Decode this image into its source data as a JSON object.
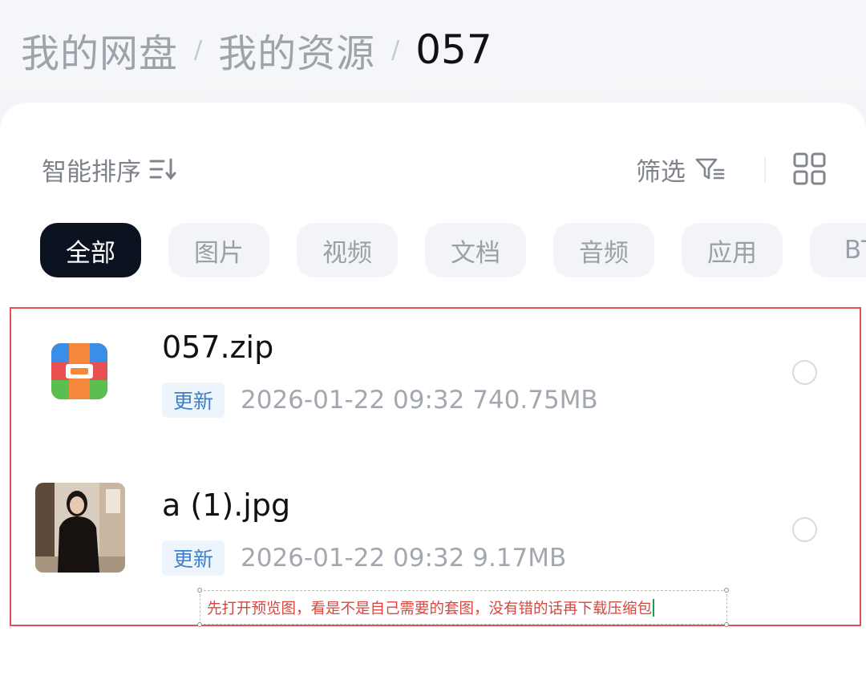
{
  "breadcrumb": {
    "items": [
      "我的网盘",
      "我的资源"
    ],
    "separator": "/",
    "current": "057"
  },
  "toolbar": {
    "sort_label": "智能排序",
    "sort_icon": "sort-icon",
    "filter_label": "筛选",
    "filter_icon": "filter-icon",
    "view_toggle_icon": "grid-view-icon"
  },
  "filter_chips": [
    "全部",
    "图片",
    "视频",
    "文档",
    "音频",
    "应用",
    "BT"
  ],
  "active_chip": "全部",
  "files": [
    {
      "name": "057.zip",
      "badge": "更新",
      "meta": "2026-01-22  09:32  740.75MB",
      "icon": "zip-archive-icon",
      "selected": false
    },
    {
      "name": "a (1).jpg",
      "badge": "更新",
      "meta": "2026-01-22  09:32  9.17MB",
      "icon": "photo-thumbnail",
      "selected": false
    }
  ],
  "annotation": {
    "text": "先打开预览图，看是不是自己需要的套图，没有错的话再下载压缩包"
  },
  "colors": {
    "active_chip_bg": "#0b1320",
    "badge_text": "#3d7fc9",
    "annotation_frame": "#e05256",
    "annotation_text": "#d9463d"
  }
}
